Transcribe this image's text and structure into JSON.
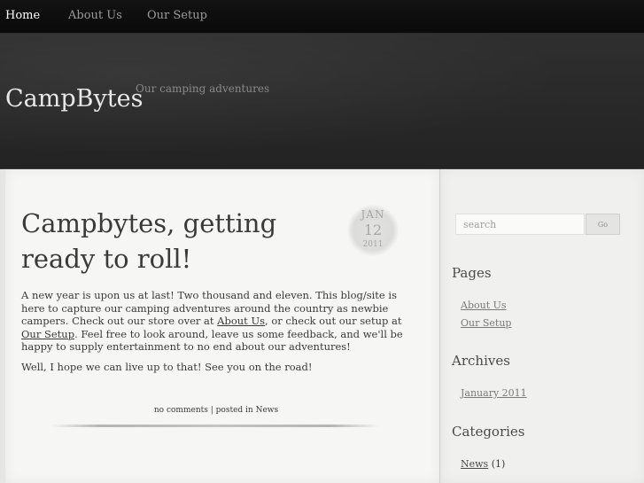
{
  "nav": {
    "items": [
      {
        "label": "Home",
        "active": true
      },
      {
        "label": "About Us",
        "active": false
      },
      {
        "label": "Our Setup",
        "active": false
      }
    ]
  },
  "header": {
    "site_title": "CampBytes",
    "tagline": "Our camping adventures"
  },
  "post": {
    "title": "Campbytes, getting ready to roll!",
    "date": {
      "month": "JAN",
      "day": "12",
      "year": "2011"
    },
    "paragraph1": {
      "t1": "A new year is upon us at last! Two thousand and eleven. This blog/site is here to capture our camping adventures around the country as newbie campers. Check out our store over at ",
      "link1": "About Us",
      "t2": ", or check out our setup at ",
      "link2": "Our Setup",
      "t3": ". Feel free to look around, leave us some feedback, and we'll be happy to supply entertainment to no end about our adventures!"
    },
    "paragraph2": "Well, I hope we can live up to that! See you on the road!",
    "meta": {
      "comments": "no comments",
      "separator": "|",
      "posted_in": "posted in",
      "category": "News"
    }
  },
  "sidebar": {
    "search": {
      "placeholder": "search",
      "button": "Go"
    },
    "pages": {
      "heading": "Pages",
      "links": [
        "About Us",
        "Our Setup"
      ]
    },
    "archives": {
      "heading": "Archives",
      "links": [
        "January 2011"
      ]
    },
    "categories": {
      "heading": "Categories",
      "items": [
        {
          "label": "News",
          "count": "(1)"
        }
      ]
    }
  },
  "colors": {
    "nav_bg": "#0f0f0f",
    "header_bg": "#2a2a2a",
    "content_bg": "#f6f6f4",
    "text": "#3a3a3a",
    "nav_active": "#ffffff",
    "nav_inactive": "#9a9a9a"
  }
}
